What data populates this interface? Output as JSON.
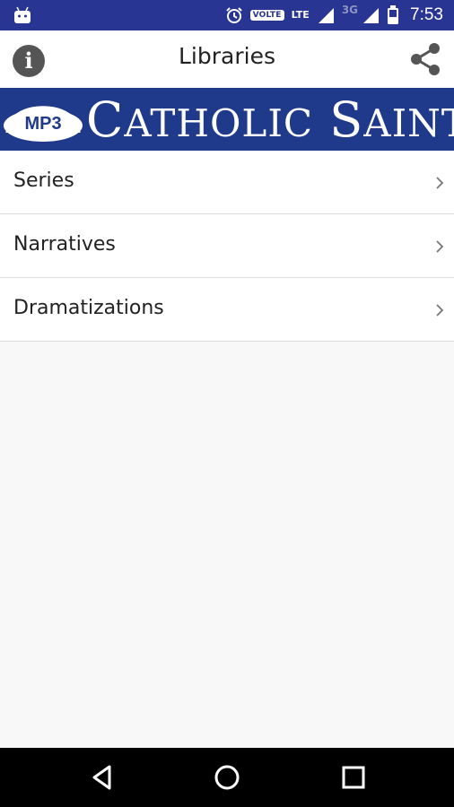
{
  "status_bar": {
    "volte": "VOLTE",
    "lte": "LTE",
    "network_3g": "3G",
    "time": "7:53",
    "icons": [
      "android-icon",
      "alarm-icon",
      "signal-icon",
      "battery-icon"
    ],
    "background": "#283593"
  },
  "toolbar": {
    "title": "Libraries",
    "info_icon": "info-icon",
    "share_icon": "share-icon"
  },
  "banner": {
    "badge": "MP3",
    "title_big_1": "C",
    "title_small_1": "ATHOLIC",
    "title_big_2": "S",
    "title_small_2": "AINTS",
    "background": "#1f3a8a"
  },
  "list": {
    "items": [
      {
        "label": "Series"
      },
      {
        "label": "Narratives"
      },
      {
        "label": "Dramatizations"
      }
    ]
  },
  "nav_bar": {
    "icons": [
      "back-icon",
      "home-icon",
      "recents-icon"
    ]
  }
}
